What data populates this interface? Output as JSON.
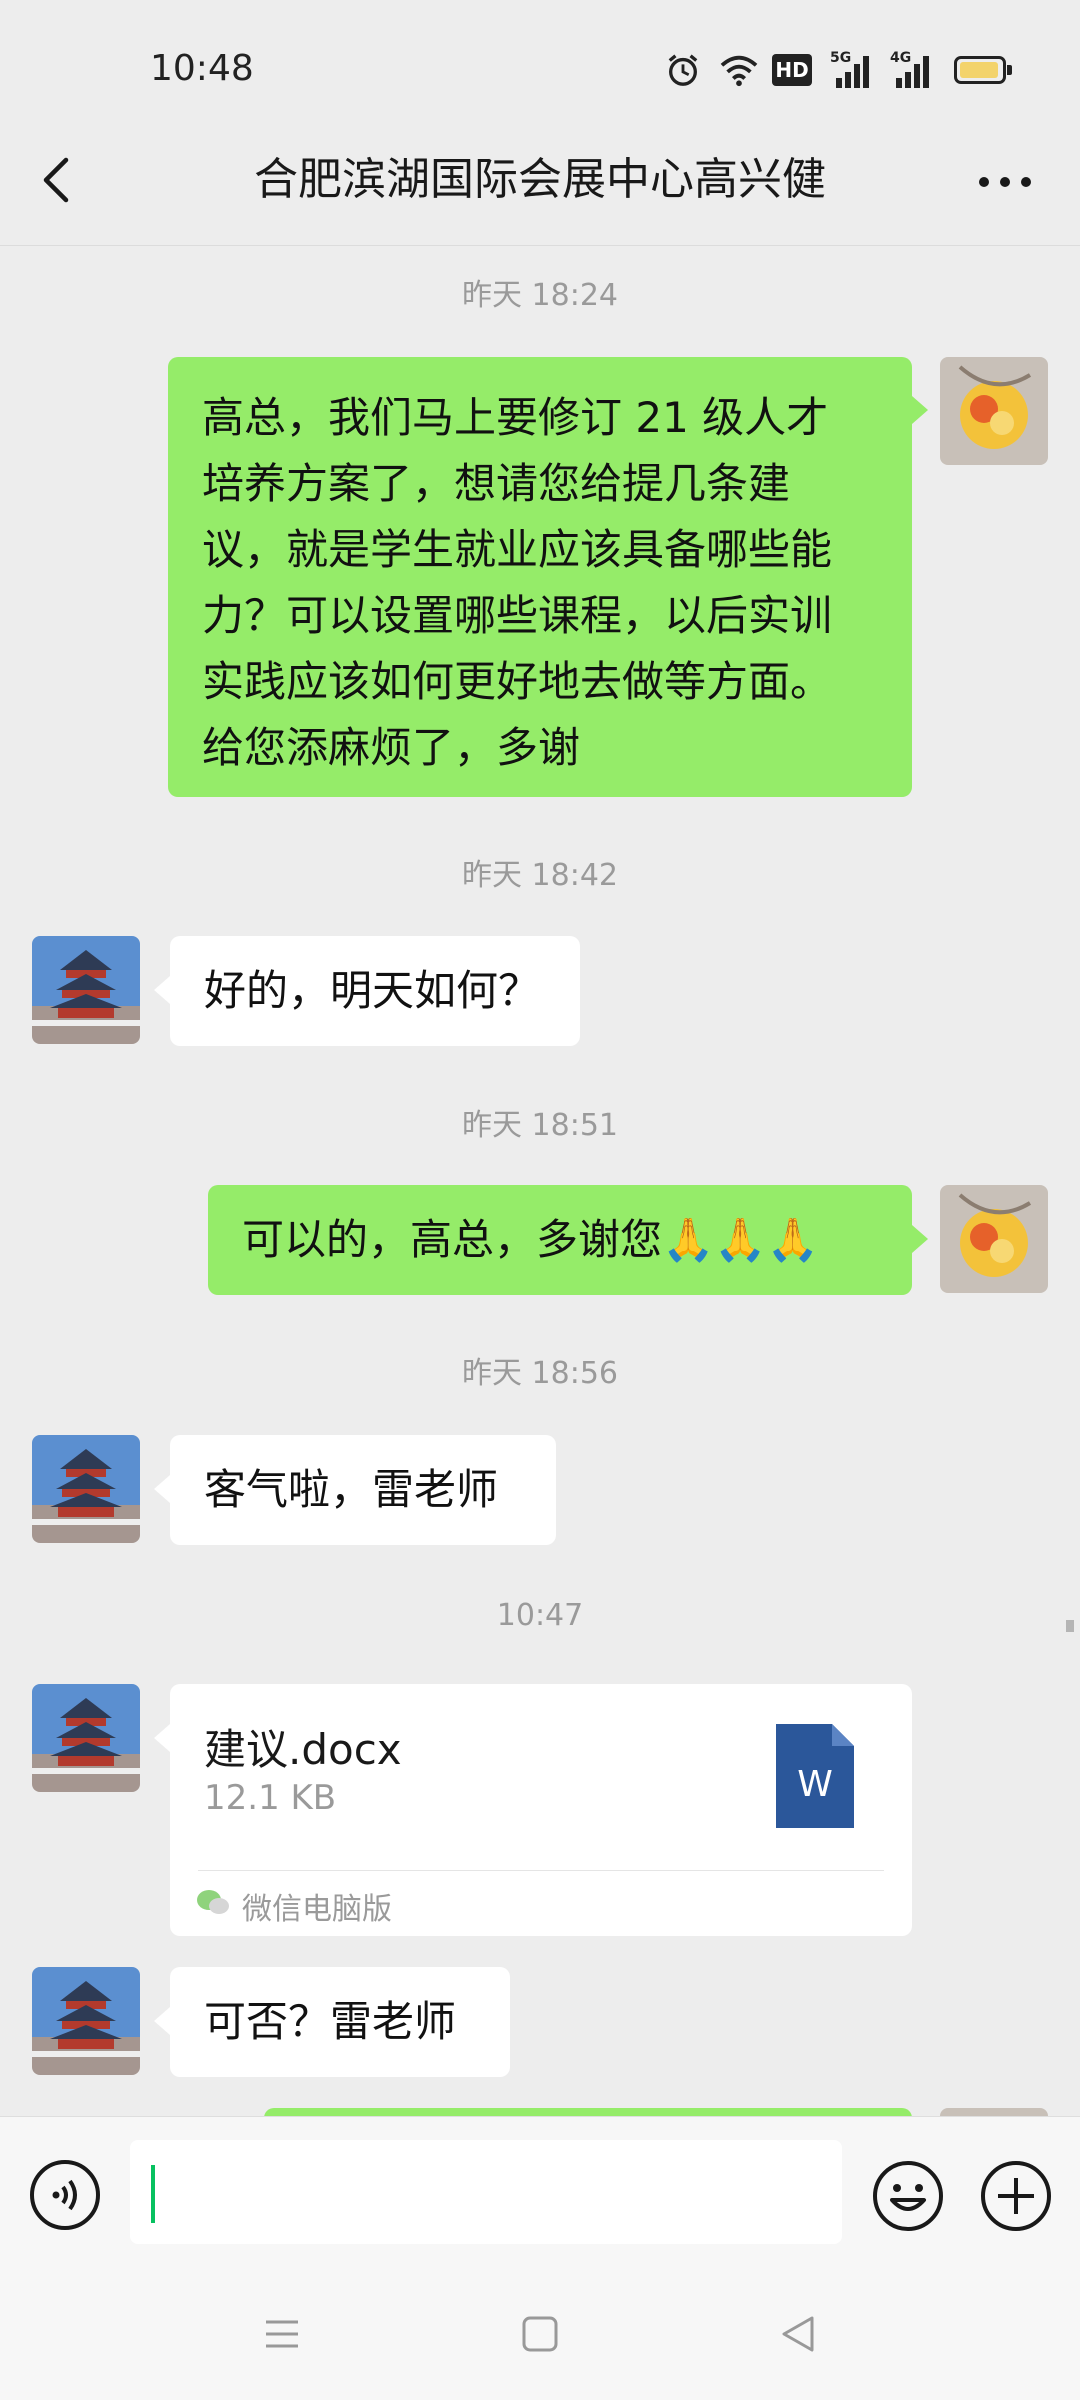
{
  "status_bar": {
    "time": "10:48",
    "icons": [
      "alarm-icon",
      "wifi-icon",
      "hd-icon",
      "5g-signal-icon",
      "4g-signal-icon",
      "battery-icon"
    ],
    "hd_label": "HD",
    "net1": "5G",
    "net2": "4G"
  },
  "header": {
    "title": "合肥滨湖国际会展中心高兴健",
    "back_icon": "chevron-left-icon",
    "more_icon": "more-dots-icon"
  },
  "messages": [
    {
      "type": "timestamp",
      "text": "昨天 18:24"
    },
    {
      "type": "text",
      "sender": "me",
      "lines": [
        "高总，我们马上要修订 21 级人才",
        "培养方案了，想请您给提几条建",
        "议，就是学生就业应该具备哪些能",
        "力？可以设置哪些课程，以后实训",
        "实践应该如何更好地去做等方面。",
        "给您添麻烦了，多谢"
      ]
    },
    {
      "type": "timestamp",
      "text": "昨天 18:42"
    },
    {
      "type": "text",
      "sender": "them",
      "lines": [
        "好的，明天如何？"
      ]
    },
    {
      "type": "timestamp",
      "text": "昨天 18:51"
    },
    {
      "type": "text",
      "sender": "me",
      "lines": [
        "可以的，高总，多谢您🙏🙏🙏"
      ]
    },
    {
      "type": "timestamp",
      "text": "昨天 18:56"
    },
    {
      "type": "text",
      "sender": "them",
      "lines": [
        "客气啦，雷老师"
      ]
    },
    {
      "type": "timestamp",
      "text": "10:47"
    },
    {
      "type": "file",
      "sender": "them",
      "filename": "建议.docx",
      "size": "12.1 KB",
      "file_icon": "word-file-icon",
      "file_icon_letter": "W",
      "source": "微信电脑版"
    },
    {
      "type": "text",
      "sender": "them",
      "lines": [
        "可否？雷老师"
      ]
    }
  ],
  "input_bar": {
    "voice_icon": "voice-icon",
    "emoji_icon": "emoji-icon",
    "plus_icon": "plus-icon",
    "text": ""
  },
  "nav_bar": {
    "icons": [
      "menu-icon",
      "home-icon",
      "back-triangle-icon"
    ]
  },
  "colors": {
    "bubble_me": "#95ec69",
    "bubble_them": "#ffffff",
    "background": "#ededed",
    "caret": "#07c160",
    "word_blue": "#2b579a"
  }
}
